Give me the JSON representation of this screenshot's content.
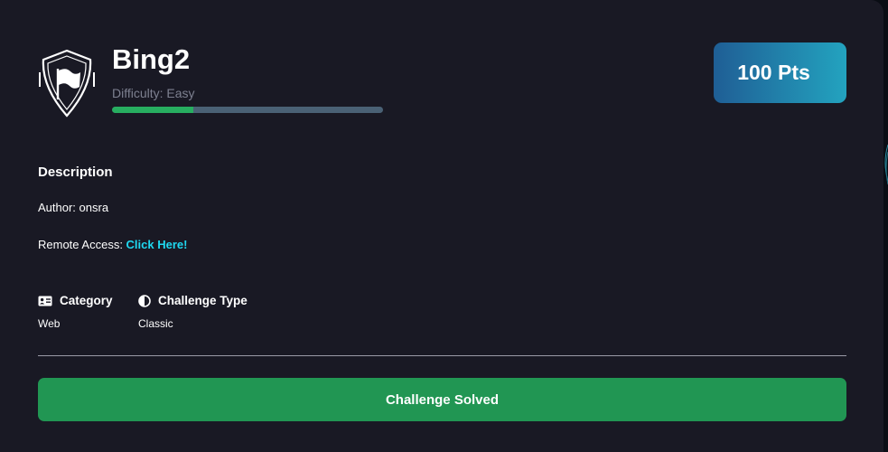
{
  "challenge": {
    "title": "Bing2",
    "difficulty": "Difficulty: Easy",
    "difficulty_level": 0.3,
    "points": "100 Pts"
  },
  "description": {
    "heading": "Description",
    "author": "Author: onsra",
    "remote_label": "Remote Access: ",
    "remote_link": "Click Here!"
  },
  "meta": {
    "category_label": "Category",
    "category_value": "Web",
    "type_label": "Challenge Type",
    "type_value": "Classic"
  },
  "action": {
    "button_label": "Challenge Solved"
  },
  "colors": {
    "card_bg": "#191924",
    "accent_link": "#1fd8f0",
    "success": "#219653",
    "progress": "#27ae60",
    "points_gradient_start": "#1f5e95",
    "points_gradient_end": "#23a3bf"
  },
  "icons": {
    "badge": "shield-flag-icon",
    "category": "id-card-icon",
    "type": "half-circle-icon"
  }
}
